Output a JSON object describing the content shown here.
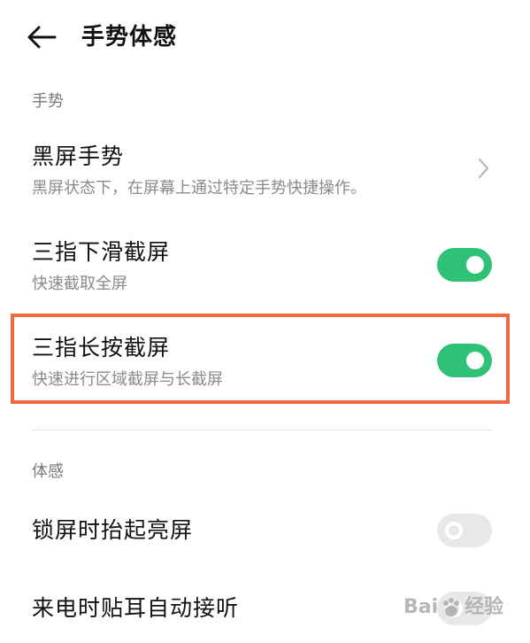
{
  "header": {
    "title": "手势体感"
  },
  "sections": {
    "gesture": {
      "label": "手势",
      "items": [
        {
          "title": "黑屏手势",
          "subtitle": "黑屏状态下，在屏幕上通过特定手势快捷操作。",
          "control": "chevron"
        },
        {
          "title": "三指下滑截屏",
          "subtitle": "快速截取全屏",
          "control": "toggle",
          "state": "on"
        },
        {
          "title": "三指长按截屏",
          "subtitle": "快速进行区域截屏与长截屏",
          "control": "toggle",
          "state": "on"
        }
      ]
    },
    "motion": {
      "label": "体感",
      "items": [
        {
          "title": "锁屏时抬起亮屏",
          "control": "toggle",
          "state": "off"
        },
        {
          "title": "来电时贴耳自动接听",
          "control": "toggle",
          "state": "off"
        }
      ]
    }
  },
  "colors": {
    "toggle_on": "#2fc277",
    "toggle_off": "#e8e8e8",
    "highlight": "#ef6a3f"
  },
  "watermark": {
    "left_text": "Bai",
    "right_text": "经验"
  }
}
